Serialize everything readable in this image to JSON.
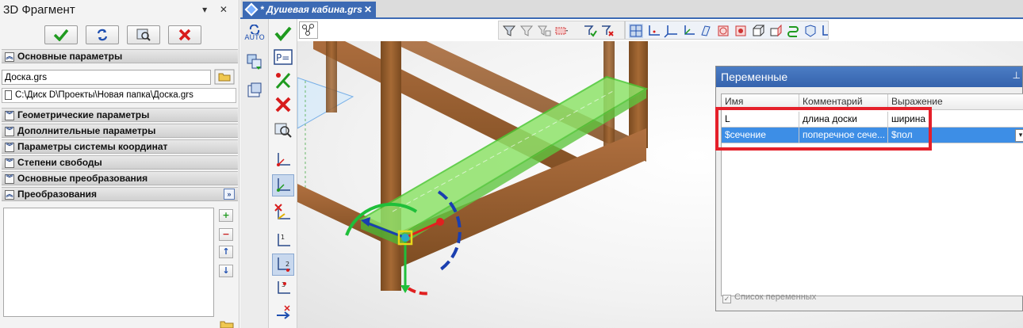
{
  "left_panel": {
    "title": "3D Фрагмент",
    "title_tools": "▾ ✕",
    "buttons": [
      {
        "name": "ok",
        "icon": "checkmark-icon"
      },
      {
        "name": "refresh",
        "icon": "refresh-icon"
      },
      {
        "name": "preview",
        "icon": "preview-icon"
      },
      {
        "name": "cancel",
        "icon": "close-icon"
      }
    ],
    "sections": {
      "main_params": "Основные параметры",
      "geometric_params": "Геометрические параметры",
      "additional_params": "Дополнительные параметры",
      "coordinate_params": "Параметры системы координат",
      "degrees_of_freedom": "Степени свободы",
      "basic_transforms": "Основные преобразования",
      "transforms": "Преобразования"
    },
    "file_name": "Доска.grs",
    "file_path": "C:\\Диск D\\Проекты\\Новая папка\\Доска.grs",
    "side_buttons": [
      "+",
      "−",
      "↑",
      "↓"
    ]
  },
  "document_tab": {
    "title": "* Душевая кабина.grs",
    "close": "✕"
  },
  "toolbar": {
    "auto_label": "AUTO"
  },
  "variables_dialog": {
    "title": "Переменные",
    "pin": "⊥",
    "columns": [
      "Имя",
      "Комментарий",
      "Выражение"
    ],
    "rows": [
      {
        "name": "L",
        "comment": "длина доски",
        "expression": "ширина"
      },
      {
        "name": "$сечение",
        "comment": "поперечное сече...",
        "expression": "$пол"
      }
    ],
    "dropdown_arrow": "▾",
    "checkbox_label": "Список переменных",
    "checkbox_checked": true
  },
  "colors": {
    "accent": "#3c6ab4",
    "selection": "#3d8ee6",
    "highlight_box": "#e5202a",
    "wood": "#9a6030",
    "selected_board": "#6fd84a"
  }
}
